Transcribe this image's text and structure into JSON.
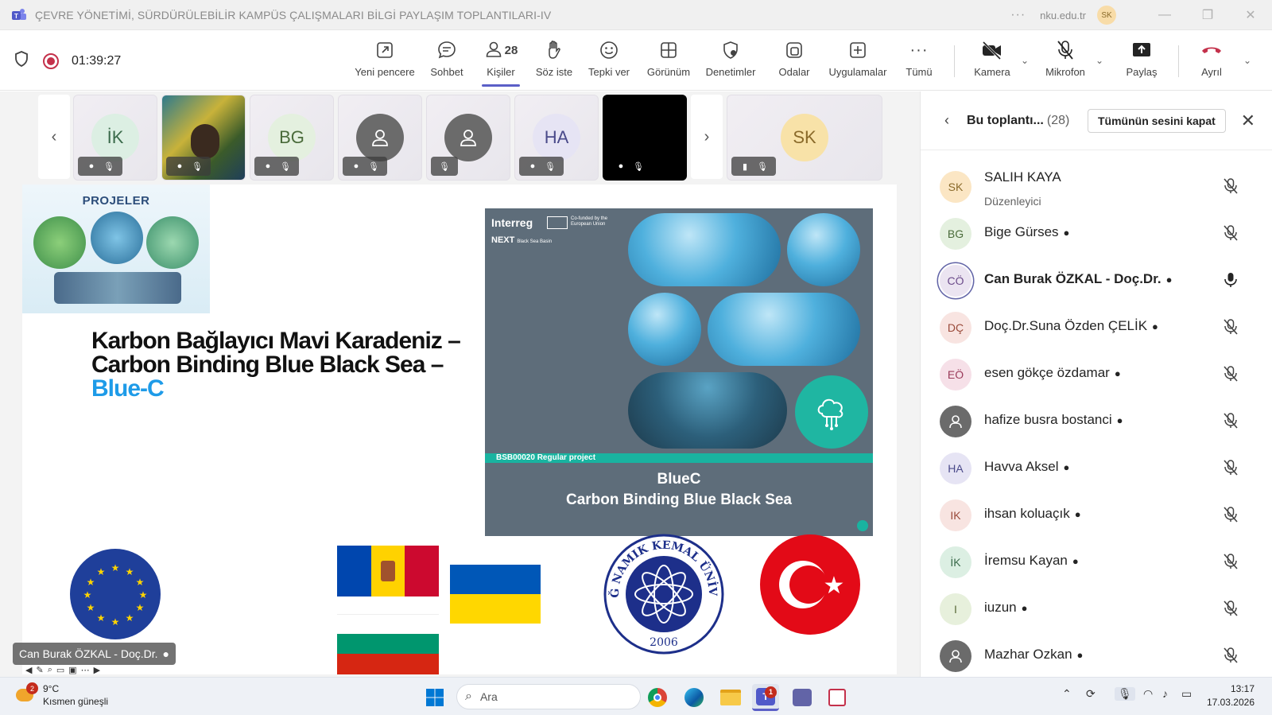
{
  "window": {
    "title": "ÇEVRE YÖNETİMİ, SÜRDÜRÜLEBİLİR KAMPÜS ÇALIŞMALARI BİLGİ PAYLAŞIM TOPLANTILARI-IV",
    "domain": "nku.edu.tr",
    "user_initials": "SK",
    "more": "···"
  },
  "toolbar": {
    "timer": "01:39:27",
    "buttons": [
      {
        "label": "Yeni pencere",
        "icon": "popout-icon"
      },
      {
        "label": "Sohbet",
        "icon": "chat-icon"
      },
      {
        "label": "Kişiler",
        "icon": "people-icon",
        "count": "28"
      },
      {
        "label": "Söz iste",
        "icon": "raise-hand-icon"
      },
      {
        "label": "Tepki ver",
        "icon": "react-icon"
      },
      {
        "label": "Görünüm",
        "icon": "view-icon"
      },
      {
        "label": "Denetimler",
        "icon": "shield-settings-icon"
      },
      {
        "label": "Odalar",
        "icon": "rooms-icon"
      },
      {
        "label": "Uygulamalar",
        "icon": "apps-icon"
      },
      {
        "label": "Tümü",
        "icon": "more-icon"
      },
      {
        "label": "Kamera",
        "icon": "camera-off-icon"
      },
      {
        "label": "Mikrofon",
        "icon": "mic-off-icon"
      },
      {
        "label": "Paylaş",
        "icon": "share-icon"
      },
      {
        "label": "Ayrıl",
        "icon": "hangup-icon"
      }
    ]
  },
  "tiles": [
    {
      "initials": "İK",
      "bg": "#dcefe3",
      "fg": "#3b6b4b"
    },
    {
      "initials": "",
      "bg": "#2f5e73",
      "fg": "#fff"
    },
    {
      "initials": "BG",
      "bg": "#e4f0df",
      "fg": "#4a6b3a"
    },
    {
      "initials": "",
      "bg": "#6b6b6b",
      "fg": "#fff"
    },
    {
      "initials": "",
      "bg": "#6b6b6b",
      "fg": "#fff"
    },
    {
      "initials": "HA",
      "bg": "#e6e4f4",
      "fg": "#4a4a8a"
    },
    {
      "initials": "",
      "bg": "#000000",
      "fg": "#fff"
    },
    {
      "initials": "SK",
      "bg": "#f8e2a8",
      "fg": "#8a6a2a"
    }
  ],
  "slide": {
    "projeler_label": "PROJELER",
    "title_line1": "Karbon Bağlayıcı Mavi Karadeniz –",
    "title_line2": "Carbon Binding Blue Black Sea –",
    "title_line3": "Blue-C",
    "card": {
      "brand": "Interreg",
      "cofunded": "Co-funded by the European Union",
      "next": "NEXT",
      "next_sub": "Black Sea Basin",
      "band": "BSB00020 Regular project",
      "title1": "BlueC",
      "title2": "Carbon Binding Blue Black Sea"
    },
    "nku_text": "TEKİRDAĞ NAMIK KEMAL ÜNİVERSİTESİ",
    "nku_year": "2006"
  },
  "presenter_badge": "Can Burak ÖZKAL - Doç.Dr.",
  "panel": {
    "title": "Bu toplantı...",
    "count": "(28)",
    "mute_all": "Tümünün sesini kapat",
    "people": [
      {
        "initials": "SK",
        "name": "SALIH KAYA",
        "role": "Düzenleyici",
        "bg": "#fbe6c4",
        "fg": "#8a6a2a",
        "mic": "off",
        "bold": false
      },
      {
        "initials": "BG",
        "name": "Bige Gürses",
        "role": "",
        "bg": "#e4f0df",
        "fg": "#4a6b3a",
        "mic": "off",
        "bold": false
      },
      {
        "initials": "CÖ",
        "name": "Can Burak ÖZKAL - Doç.Dr.",
        "role": "",
        "bg": "#ebe4f1",
        "fg": "#6b4a8a",
        "mic": "on",
        "bold": true
      },
      {
        "initials": "DÇ",
        "name": "Doç.Dr.Suna Özden ÇELİK",
        "role": "",
        "bg": "#f8e4e1",
        "fg": "#9a4a3a",
        "mic": "off",
        "bold": false
      },
      {
        "initials": "EÖ",
        "name": "esen gökçe özdamar",
        "role": "",
        "bg": "#f6e0e8",
        "fg": "#9a3a5a",
        "mic": "off",
        "bold": false
      },
      {
        "initials": "",
        "name": "hafize busra bostanci",
        "role": "",
        "bg": "#6b6b6b",
        "fg": "#fff",
        "mic": "off",
        "bold": false
      },
      {
        "initials": "HA",
        "name": "Havva Aksel",
        "role": "",
        "bg": "#e6e4f4",
        "fg": "#4a4a8a",
        "mic": "off",
        "bold": false
      },
      {
        "initials": "IK",
        "name": "ihsan koluaçık",
        "role": "",
        "bg": "#f8e4e1",
        "fg": "#9a4a3a",
        "mic": "off",
        "bold": false
      },
      {
        "initials": "İK",
        "name": "İremsu Kayan",
        "role": "",
        "bg": "#dcefe3",
        "fg": "#3b6b4b",
        "mic": "off",
        "bold": false
      },
      {
        "initials": "I",
        "name": "iuzun",
        "role": "",
        "bg": "#e7f0dc",
        "fg": "#5a6b3a",
        "mic": "off",
        "bold": false
      },
      {
        "initials": "",
        "name": "Mazhar Ozkan",
        "role": "",
        "bg": "#6b6b6b",
        "fg": "#fff",
        "mic": "off",
        "bold": false
      }
    ]
  },
  "taskbar": {
    "temp": "9°C",
    "weather": "Kısmen güneşli",
    "weather_badge": "2",
    "search": "Ara",
    "teams_badge": "1",
    "time": "13:17",
    "date": "17.03.2026"
  }
}
